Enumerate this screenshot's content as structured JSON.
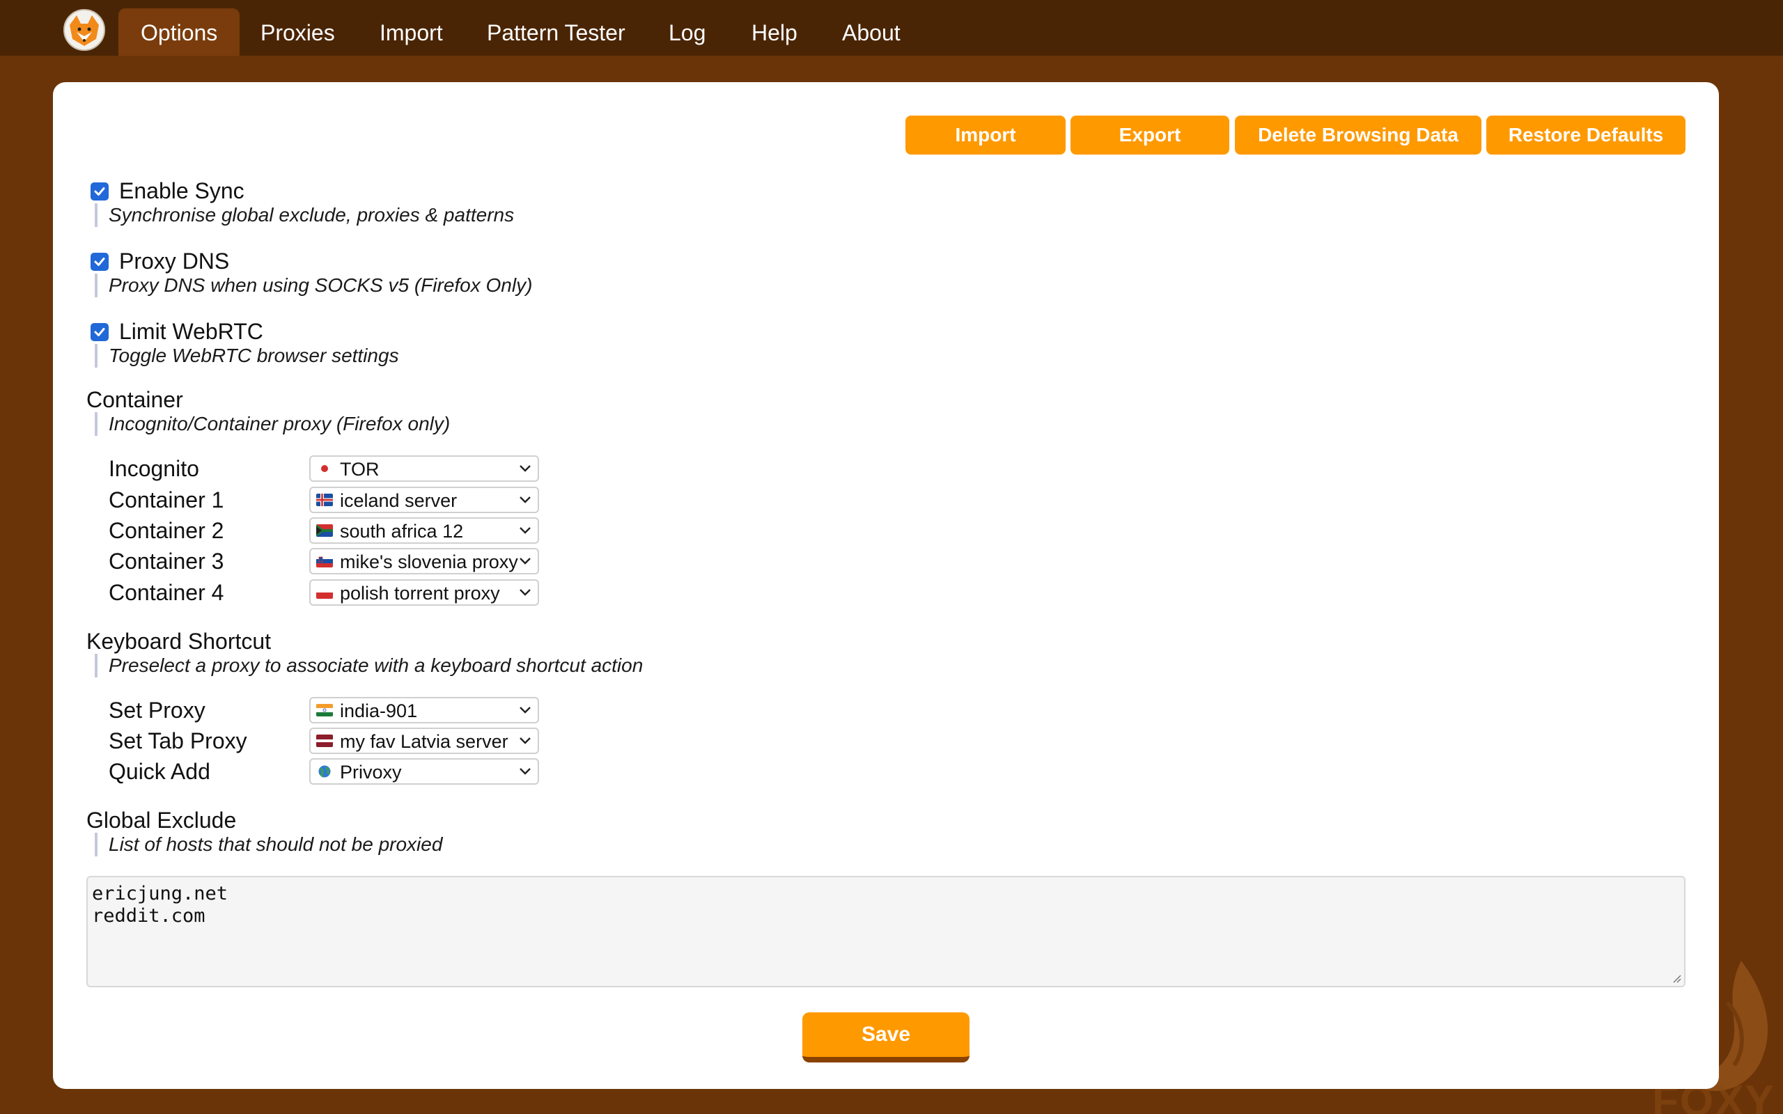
{
  "nav": {
    "tabs": [
      {
        "label": "Options"
      },
      {
        "label": "Proxies"
      },
      {
        "label": "Import"
      },
      {
        "label": "Pattern Tester"
      },
      {
        "label": "Log"
      },
      {
        "label": "Help"
      },
      {
        "label": "About"
      }
    ],
    "active_tab": "Options"
  },
  "actions": {
    "import_label": "Import",
    "export_label": "Export",
    "delete_label": "Delete Browsing Data",
    "restore_label": "Restore Defaults"
  },
  "settings": {
    "sync": {
      "label": "Enable Sync",
      "checked": true,
      "description": "Synchronise global exclude, proxies & patterns"
    },
    "dns": {
      "label": "Proxy DNS",
      "checked": true,
      "description": "Proxy DNS when using SOCKS v5 (Firefox Only)"
    },
    "webrtc": {
      "label": "Limit WebRTC",
      "checked": true,
      "description": "Toggle WebRTC browser settings"
    }
  },
  "container": {
    "title": "Container",
    "description": "Incognito/Container proxy (Firefox only)",
    "rows": [
      {
        "label": "Incognito",
        "value": "TOR",
        "flag": "japan"
      },
      {
        "label": "Container 1",
        "value": "iceland server",
        "flag": "iceland"
      },
      {
        "label": "Container 2",
        "value": "south africa 12",
        "flag": "south-africa"
      },
      {
        "label": "Container 3",
        "value": "mike's slovenia proxy",
        "flag": "slovenia"
      },
      {
        "label": "Container 4",
        "value": "polish torrent proxy",
        "flag": "poland"
      }
    ]
  },
  "shortcut": {
    "title": "Keyboard Shortcut",
    "description": "Preselect a proxy to associate with a keyboard shortcut action",
    "rows": [
      {
        "label": "Set Proxy",
        "value": "india-901",
        "flag": "india"
      },
      {
        "label": "Set Tab Proxy",
        "value": "my fav Latvia server",
        "flag": "latvia"
      },
      {
        "label": "Quick Add",
        "value": "Privoxy",
        "flag": "globe"
      }
    ]
  },
  "exclude": {
    "title": "Global Exclude",
    "description": "List of hosts that should not be proxied",
    "lines": [
      "ericjung.net",
      "reddit.com"
    ]
  },
  "save_label": "Save",
  "watermark_text": "FOXY",
  "colors": {
    "accent": "#ff9900",
    "background": "#6b3408",
    "topbar": "#4a2505",
    "active_tab": "#7a3c0c",
    "checkbox": "#2168d8"
  }
}
